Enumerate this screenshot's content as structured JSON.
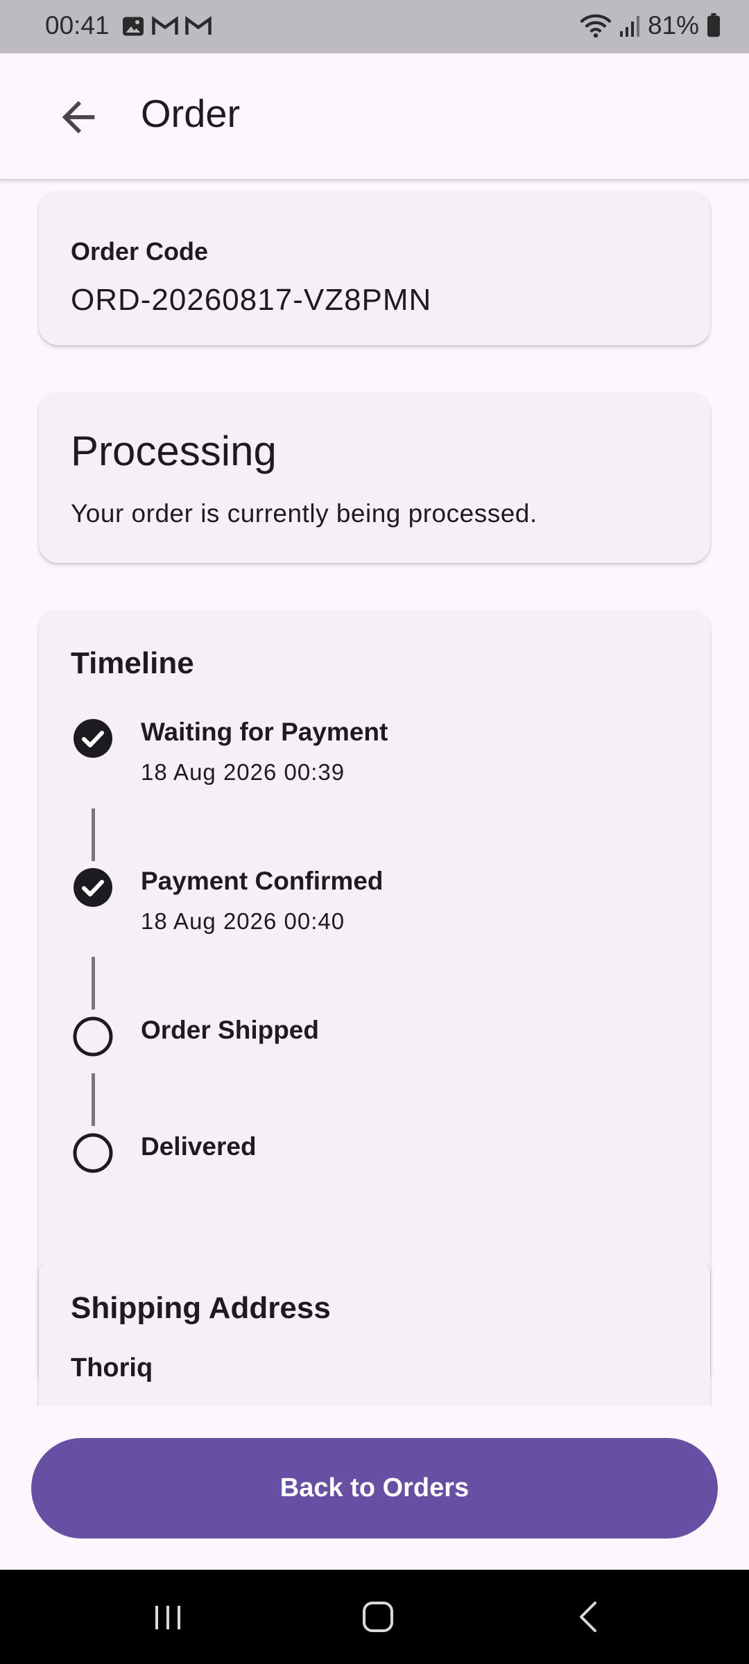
{
  "status_bar": {
    "time": "00:41",
    "battery": "81%",
    "notification_icons": [
      "gallery-icon",
      "gmail-icon",
      "gmail-icon"
    ]
  },
  "app_bar": {
    "title": "Order"
  },
  "order_code": {
    "label": "Order Code",
    "value": "ORD-20260817-VZ8PMN"
  },
  "status": {
    "title": "Processing",
    "description": "Your order is currently being processed."
  },
  "timeline": {
    "title": "Timeline",
    "steps": [
      {
        "label": "Waiting for Payment",
        "time": "18 Aug 2026 00:39",
        "done": true
      },
      {
        "label": "Payment Confirmed",
        "time": "18 Aug 2026 00:40",
        "done": true
      },
      {
        "label": "Order Shipped",
        "time": "",
        "done": false
      },
      {
        "label": "Delivered",
        "time": "",
        "done": false
      }
    ]
  },
  "shipping_address": {
    "title": "Shipping Address",
    "name": "Thoriq"
  },
  "actions": {
    "back_to_orders": "Back to Orders"
  },
  "colors": {
    "primary": "#6750a4",
    "surface": "#fdf7fd",
    "card": "#f5f0f7",
    "statusbar": "#bdbac1"
  }
}
